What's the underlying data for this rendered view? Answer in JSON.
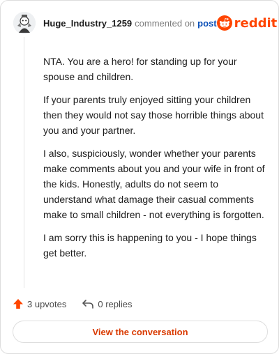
{
  "comment": {
    "username": "Huge_Industry_1259",
    "commented_text": "commented on",
    "post_link_label": "post",
    "brand_name": "reddit",
    "paragraphs": [
      "NTA. You are a hero! for standing up for your spouse and children.",
      "If your parents truly enjoyed sitting your children then they would not say those horrible things about you and your partner.",
      "I also, suspiciously, wonder whether your parents make comments about you and your wife in front of the kids. Honestly, adults do not seem to understand what damage their casual comments make to small children - not everything is forgotten.",
      "I am sorry this is happening to you - I hope things get better."
    ]
  },
  "actions": {
    "upvotes_label": "3 upvotes",
    "replies_label": "0 replies",
    "view_conversation_label": "View the conversation"
  },
  "icons": {
    "avatar": "avatar-icon",
    "brand_logo": "reddit-logo-icon",
    "upvote": "upvote-arrow-icon",
    "reply": "reply-arrow-icon"
  },
  "colors": {
    "brand": "#ff4500",
    "link": "#0a4fb8",
    "button_text": "#d93a00"
  }
}
